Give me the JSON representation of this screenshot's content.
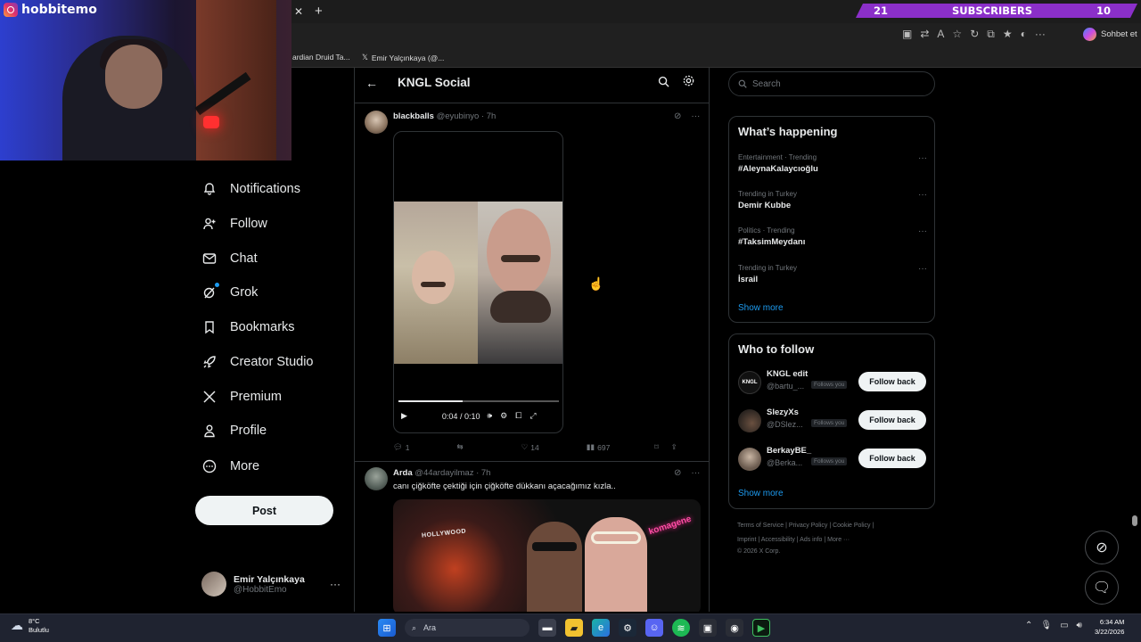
{
  "overlay": {
    "streamer_handle": "hobbitemo",
    "subscriber_bar": {
      "left": "21",
      "label": "SUBSCRIBERS",
      "right": "10"
    }
  },
  "browser": {
    "copilot_label": "Sohbet et",
    "bookmarks": [
      {
        "label": "ardian Druid Ta..."
      },
      {
        "label": "Emir Yalçınkaya (@..."
      }
    ]
  },
  "nav": {
    "items": [
      {
        "label": "Notifications",
        "icon": "bell-icon"
      },
      {
        "label": "Follow",
        "icon": "person-plus-icon"
      },
      {
        "label": "Chat",
        "icon": "envelope-icon"
      },
      {
        "label": "Grok",
        "icon": "grok-icon"
      },
      {
        "label": "Bookmarks",
        "icon": "bookmark-icon"
      },
      {
        "label": "Creator Studio",
        "icon": "rocket-icon"
      },
      {
        "label": "Premium",
        "icon": "x-logo-icon"
      },
      {
        "label": "Profile",
        "icon": "person-icon"
      },
      {
        "label": "More",
        "icon": "more-circle-icon"
      }
    ],
    "post_label": "Post",
    "account": {
      "name": "Emir Yalçınkaya",
      "handle": "@HobbitEmo"
    }
  },
  "header": {
    "title": "KNGL Social"
  },
  "tweets": [
    {
      "name": "blackballs",
      "handle": "@eyubinyo",
      "time": "· 7h",
      "video": {
        "time": "0:04 / 0:10",
        "progress": 0.4
      },
      "replies": "1",
      "likes": "14",
      "views": "697"
    },
    {
      "name": "Arda",
      "handle": "@44ardayilmaz",
      "time": "· 7h",
      "text": "canı çiğköfte çektiği için çiğköfte dükkanı açacağımız kızla..",
      "photo_sign": "HOLLYWOOD",
      "photo_neon": "komagene"
    }
  ],
  "sidebar": {
    "search_placeholder": "Search",
    "happening": {
      "title": "What’s happening",
      "trends": [
        {
          "meta": "Entertainment · Trending",
          "name": "#AleynaKalaycıoğlu"
        },
        {
          "meta": "Trending in Turkey",
          "name": "Demir Kubbe"
        },
        {
          "meta": "Politics · Trending",
          "name": "#TaksimMeydanı"
        },
        {
          "meta": "Trending in Turkey",
          "name": "İsrail"
        }
      ],
      "show_more": "Show more"
    },
    "who_to_follow": {
      "title": "Who to follow",
      "accounts": [
        {
          "name": "KNGL edit",
          "handle": "@bartu_...",
          "badge": "Follows you",
          "button": "Follow back"
        },
        {
          "name": "SlezyXs",
          "handle": "@DSlez...",
          "badge": "Follows you",
          "button": "Follow back"
        },
        {
          "name": "BerkayBE_",
          "handle": "@Berka...",
          "badge": "Follows you",
          "button": "Follow back"
        }
      ],
      "show_more": "Show more"
    },
    "footer": {
      "line1": "Terms of Service  |  Privacy Policy  |  Cookie Policy  |",
      "line2": "Imprint  |  Accessibility  |  Ads info  |  More ···",
      "line3": "© 2026 X Corp."
    }
  },
  "taskbar": {
    "weather_temp": "8°C",
    "weather_desc": "Bulutlu",
    "search_label": "Ara",
    "time": "6:34 AM",
    "date": "3/22/2026"
  },
  "colors": {
    "accent": "#1d9bf0",
    "overlay_bar": "#8b2fc9",
    "background": "#000000"
  }
}
